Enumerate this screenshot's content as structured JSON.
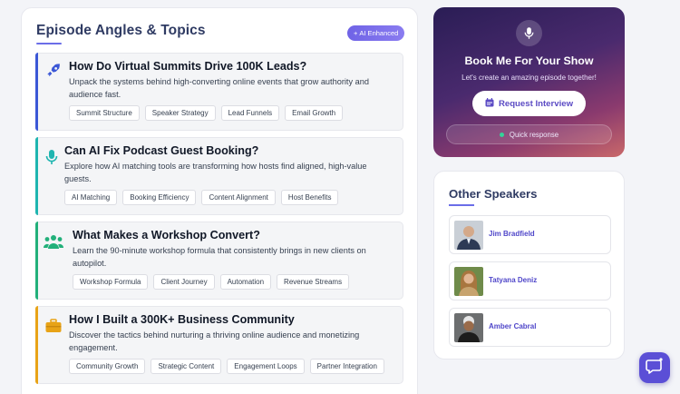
{
  "topics_section": {
    "title": "Episode Angles & Topics",
    "badge": "AI Enhanced",
    "topics": [
      {
        "icon": "rocket-icon",
        "color": "#3b57d6",
        "title": "How Do Virtual Summits Drive 100K Leads?",
        "description": "Unpack the systems behind high-converting online events that grow authority and audience fast.",
        "tags": [
          "Summit Structure",
          "Speaker Strategy",
          "Lead Funnels",
          "Email Growth"
        ]
      },
      {
        "icon": "microphone-icon",
        "color": "#1fb5b0",
        "title": "Can AI Fix Podcast Guest Booking?",
        "description": "Explore how AI matching tools are transforming how hosts find aligned, high-value guests.",
        "tags": [
          "AI Matching",
          "Booking Efficiency",
          "Content Alignment",
          "Host Benefits"
        ]
      },
      {
        "icon": "users-icon",
        "color": "#22b07a",
        "title": "What Makes a Workshop Convert?",
        "description": "Learn the 90-minute workshop formula that consistently brings in new clients on autopilot.",
        "tags": [
          "Workshop Formula",
          "Client Journey",
          "Automation",
          "Revenue Streams"
        ]
      },
      {
        "icon": "briefcase-icon",
        "color": "#e8a317",
        "title": "How I Built a 300K+ Business Community",
        "description": "Discover the tactics behind nurturing a thriving online audience and monetizing engagement.",
        "tags": [
          "Community Growth",
          "Strategic Content",
          "Engagement Loops",
          "Partner Integration"
        ]
      }
    ]
  },
  "booking": {
    "icon": "microphone-icon",
    "title": "Book Me For Your Show",
    "subtitle": "Let's create an amazing episode together!",
    "button_label": "Request Interview",
    "button_icon": "calendar-icon",
    "status": "Quick response"
  },
  "speakers": {
    "title": "Other Speakers",
    "items": [
      {
        "name": "Jim Bradfield"
      },
      {
        "name": "Tatyana Deniz"
      },
      {
        "name": "Amber Cabral"
      }
    ]
  },
  "chat": {
    "icon": "chat-support-icon"
  }
}
